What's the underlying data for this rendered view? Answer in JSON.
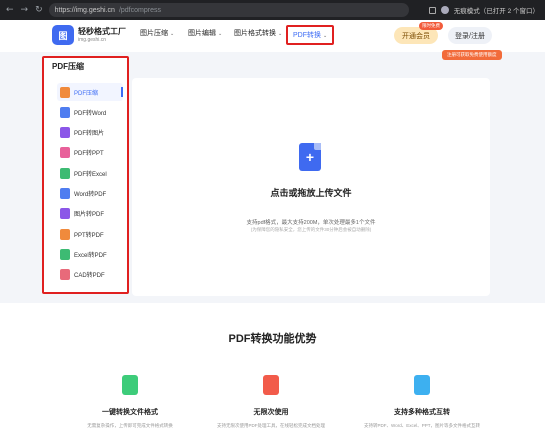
{
  "browser": {
    "nav_glyphs": [
      "←",
      "→",
      "↻"
    ],
    "url_host": "https://img.geshi.cn",
    "url_path": "/pdfcompress",
    "profile_label": "无痕模式（已打开 2 个窗口）"
  },
  "header": {
    "logo_mark": "图",
    "logo_name": "轻秒格式工厂",
    "logo_domain": "img.geshi.cn",
    "nav": [
      {
        "label": "图片压缩",
        "chevron": "⌄"
      },
      {
        "label": "图片编辑",
        "chevron": "⌄"
      },
      {
        "label": "图片格式转换",
        "chevron": "⌄"
      },
      {
        "label": "PDF转换",
        "chevron": "⌄"
      }
    ],
    "vip_label": "开通会员",
    "vip_tag": "限时免费",
    "login_label": "登录/注册",
    "login_tip": "注册可获取免费使用额度"
  },
  "sidebar": {
    "title": "PDF压缩",
    "items": [
      {
        "label": "PDF压缩",
        "color": "#f08a3c",
        "active": true
      },
      {
        "label": "PDF转Word",
        "color": "#4f7df0"
      },
      {
        "label": "PDF转图片",
        "color": "#8b56e8"
      },
      {
        "label": "PDF转PPT",
        "color": "#e8609a"
      },
      {
        "label": "PDF转Excel",
        "color": "#3dbb73"
      },
      {
        "label": "Word转PDF",
        "color": "#4f7df0"
      },
      {
        "label": "图片转PDF",
        "color": "#8b56e8"
      },
      {
        "label": "PPT转PDF",
        "color": "#f08a3c"
      },
      {
        "label": "Excel转PDF",
        "color": "#3dbb73"
      },
      {
        "label": "CAD转PDF",
        "color": "#e86a7a"
      }
    ]
  },
  "upload": {
    "icon_glyph": "+",
    "title": "点击或拖放上传文件",
    "subtitle": "支持pdf格式，最大支持200M，单次处理最多1个文件",
    "note": "(为保障您的隐私安全，您上传的文件30分钟后会被自动删除)"
  },
  "advantages": {
    "title": "PDF转换功能优势",
    "features": [
      {
        "title": "一键转换文件格式",
        "desc": "无需复杂操作，上传即可完成文件格式转换",
        "color": "#3dcc7a"
      },
      {
        "title": "无限次使用",
        "desc": "支持无限次使用PDF处理工具，在线轻松完成文档处理",
        "color": "#f25b4a"
      },
      {
        "title": "支持多种格式互转",
        "desc": "支持转PDF、Word、Excel、PPT，图片等多文件格式互转",
        "color": "#3db0f0"
      }
    ]
  }
}
